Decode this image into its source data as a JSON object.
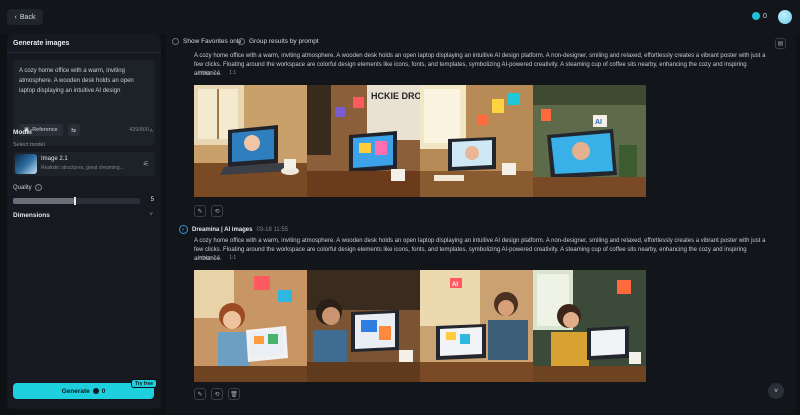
{
  "topbar": {
    "back_label": "Back",
    "credits": "0"
  },
  "sidebar": {
    "title": "Generate images",
    "prompt": "A cozy home office with a warm, inviting atmosphere. A wooden desk holds an open laptop displaying an intuitive AI design platform. A non-designer, smiling and relaxed, effortlessly",
    "reference_label": "Reference",
    "char_count": "439/800",
    "model_section": "Model",
    "select_label": "Select model",
    "model_name": "Image 2.1",
    "model_desc": "Realistic structures, great dreaming...",
    "quality_label": "Quality",
    "quality_value": "5",
    "quality_fraction": 0.48,
    "dimensions_label": "Dimensions",
    "generate_label": "Generate",
    "generate_cost": "0",
    "try_free": "Try free"
  },
  "main": {
    "show_favorites": "Show Favorites only",
    "group_results": "Group results by prompt",
    "prompt_text": "A cozy home office with a warm, inviting atmosphere. A wooden desk holds an open laptop displaying an intuitive AI design platform. A non-designer, smiling and relaxed, effortlessly creates a vibrant poster with just a few clicks. Floating around the workspace are colorful design elements like icons, fonts, and templates, symbolizing AI-powered creativity. A steaming cup of coffee sits nearby, enhancing the cozy and inspiring ambiance.",
    "model_tag": "Image 2.1",
    "ratio_tag": "1:1",
    "brand_name": "Dreamina | AI images",
    "brand_time": "03-18   11:55",
    "poster_text": "HCKIE DROPAH",
    "ai_label": "AI"
  },
  "colors": {
    "accent": "#1ed0de",
    "background": "#0f1115",
    "panel": "#161a20"
  }
}
